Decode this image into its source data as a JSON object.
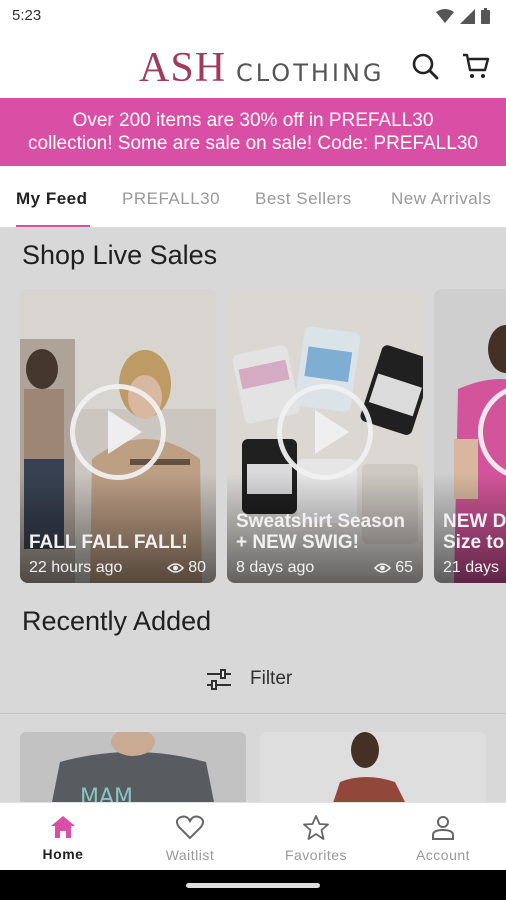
{
  "status_bar": {
    "time": "5:23"
  },
  "header": {
    "brand_main": "ASH",
    "brand_sub": "CLOTHING",
    "search_icon": "search-icon",
    "cart_icon": "cart-icon"
  },
  "promo": {
    "line1": "Over 200 items are 30% off in PREFALL30",
    "line2": "collection! Some are sale on sale! Code: PREFALL30"
  },
  "tabs": [
    {
      "label": "My Feed",
      "active": true
    },
    {
      "label": "PREFALL30"
    },
    {
      "label": "Best Sellers"
    },
    {
      "label": "New Arrivals"
    }
  ],
  "live_sales": {
    "title": "Shop Live Sales",
    "cards": [
      {
        "title": "FALL FALL FALL!",
        "age": "22 hours ago",
        "views": "80"
      },
      {
        "title": "Sweatshirt Season + NEW SWIG!",
        "title_line1": "Sweatshirt Season",
        "title_line2": "+ NEW SWIG!",
        "age": "8 days ago",
        "views": "65"
      },
      {
        "title_line1": "NEW D",
        "title_line2": "Size to",
        "age": "21 days"
      }
    ]
  },
  "recent": {
    "title": "Recently Added",
    "filter_label": "Filter"
  },
  "bottom_nav": [
    {
      "label": "Home",
      "icon": "home-icon",
      "active": true
    },
    {
      "label": "Waitlist",
      "icon": "heart-icon"
    },
    {
      "label": "Favorites",
      "icon": "star-icon"
    },
    {
      "label": "Account",
      "icon": "person-icon"
    }
  ],
  "colors": {
    "accent": "#d94fa6",
    "brand": "#a03b5e"
  }
}
